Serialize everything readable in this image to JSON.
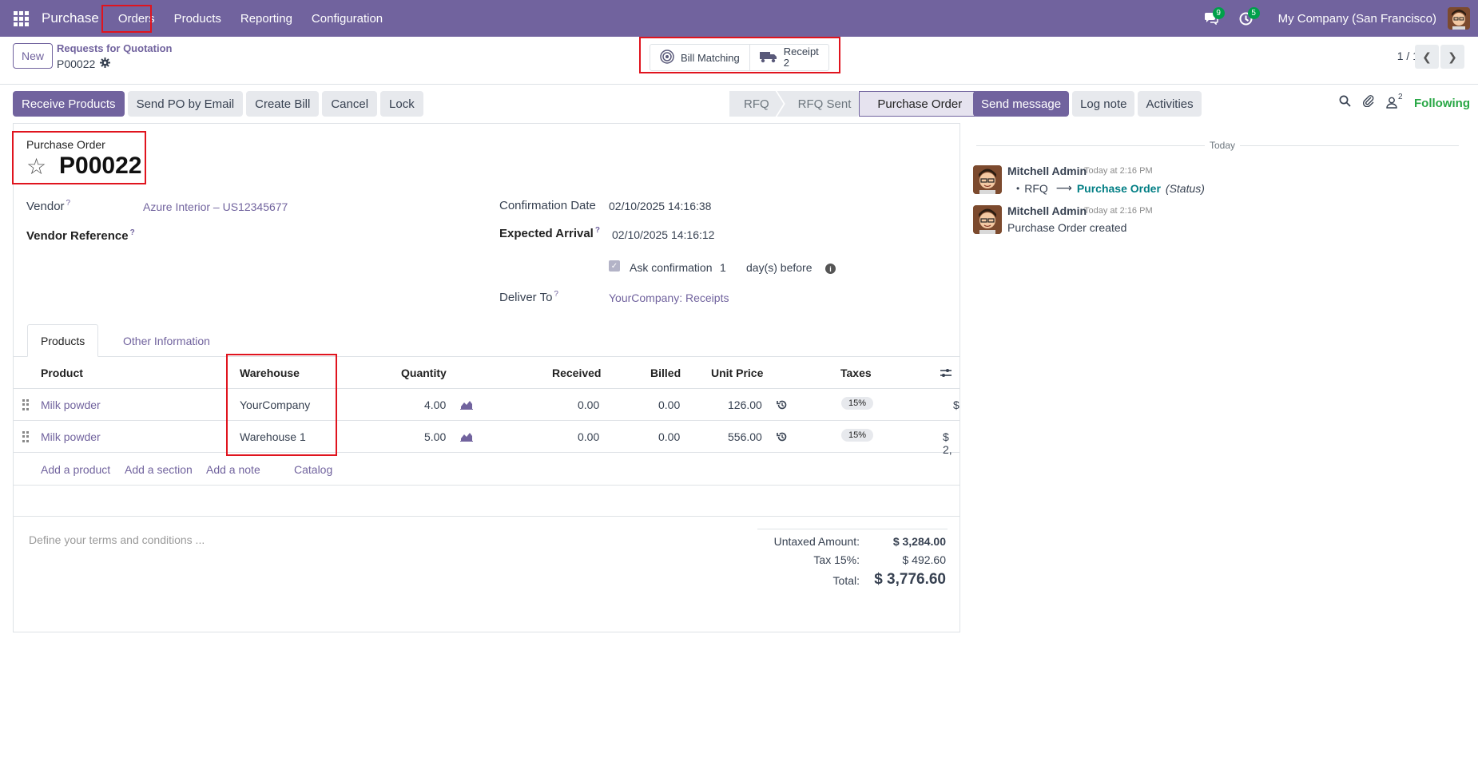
{
  "navbar": {
    "app_name": "Purchase",
    "menu": [
      "Orders",
      "Products",
      "Reporting",
      "Configuration"
    ],
    "messages_count": "9",
    "activities_count": "5",
    "company": "My Company (San Francisco)"
  },
  "control_panel": {
    "new_label": "New",
    "breadcrumb_parent": "Requests for Quotation",
    "breadcrumb_current": "P00022",
    "smart_buttons": {
      "bill_matching": "Bill Matching",
      "receipt_label": "Receipt",
      "receipt_count": "2"
    },
    "pager": "1 / 1"
  },
  "actions": [
    "Receive Products",
    "Send PO by Email",
    "Create Bill",
    "Cancel",
    "Lock"
  ],
  "statusbar": [
    "RFQ",
    "RFQ Sent",
    "Purchase Order"
  ],
  "form": {
    "title_label": "Purchase Order",
    "name": "P00022",
    "vendor_label": "Vendor",
    "vendor_value": "Azure Interior – US12345677",
    "vendor_ref_label": "Vendor Reference",
    "confirmation_date_label": "Confirmation Date",
    "confirmation_date": "02/10/2025 14:16:38",
    "expected_arrival_label": "Expected Arrival",
    "expected_arrival": "02/10/2025 14:16:12",
    "ask_confirmation_label": "Ask confirmation",
    "ask_confirmation_days": "1",
    "days_before": "day(s) before",
    "deliver_to_label": "Deliver To",
    "deliver_to": "YourCompany: Receipts",
    "help_mark": "?"
  },
  "tabs": [
    "Products",
    "Other Information"
  ],
  "table": {
    "headers": [
      "Product",
      "Warehouse",
      "Quantity",
      "Received",
      "Billed",
      "Unit Price",
      "Taxes"
    ],
    "rows": [
      {
        "product": "Milk powder",
        "warehouse": "YourCompany",
        "quantity": "4.00",
        "received": "0.00",
        "billed": "0.00",
        "unit_price": "126.00",
        "tax": "15%",
        "subtotal": "$"
      },
      {
        "product": "Milk powder",
        "warehouse": "Warehouse 1",
        "quantity": "5.00",
        "received": "0.00",
        "billed": "0.00",
        "unit_price": "556.00",
        "tax": "15%",
        "subtotal": "$ 2,"
      }
    ],
    "add_links": [
      "Add a product",
      "Add a section",
      "Add a note",
      "Catalog"
    ]
  },
  "terms_placeholder": "Define your terms and conditions ...",
  "totals": {
    "untaxed_label": "Untaxed Amount:",
    "untaxed_value": "$ 3,284.00",
    "tax_label": "Tax 15%:",
    "tax_value": "$ 492.60",
    "total_label": "Total:",
    "total_value": "$ 3,776.60"
  },
  "chatter": {
    "buttons": [
      "Send message",
      "Log note",
      "Activities"
    ],
    "followers_count": "2",
    "following": "Following",
    "today": "Today",
    "messages": [
      {
        "author": "Mitchell Admin",
        "time": "Today at 2:16 PM",
        "from": "RFQ",
        "arrow": "⟶",
        "to": "Purchase Order",
        "field": "(Status)"
      },
      {
        "author": "Mitchell Admin",
        "time": "Today at 2:16 PM",
        "body": "Purchase Order created"
      }
    ]
  },
  "colors": {
    "brand": "#71639e",
    "highlight": "#e0141e",
    "following": "#28a745"
  }
}
